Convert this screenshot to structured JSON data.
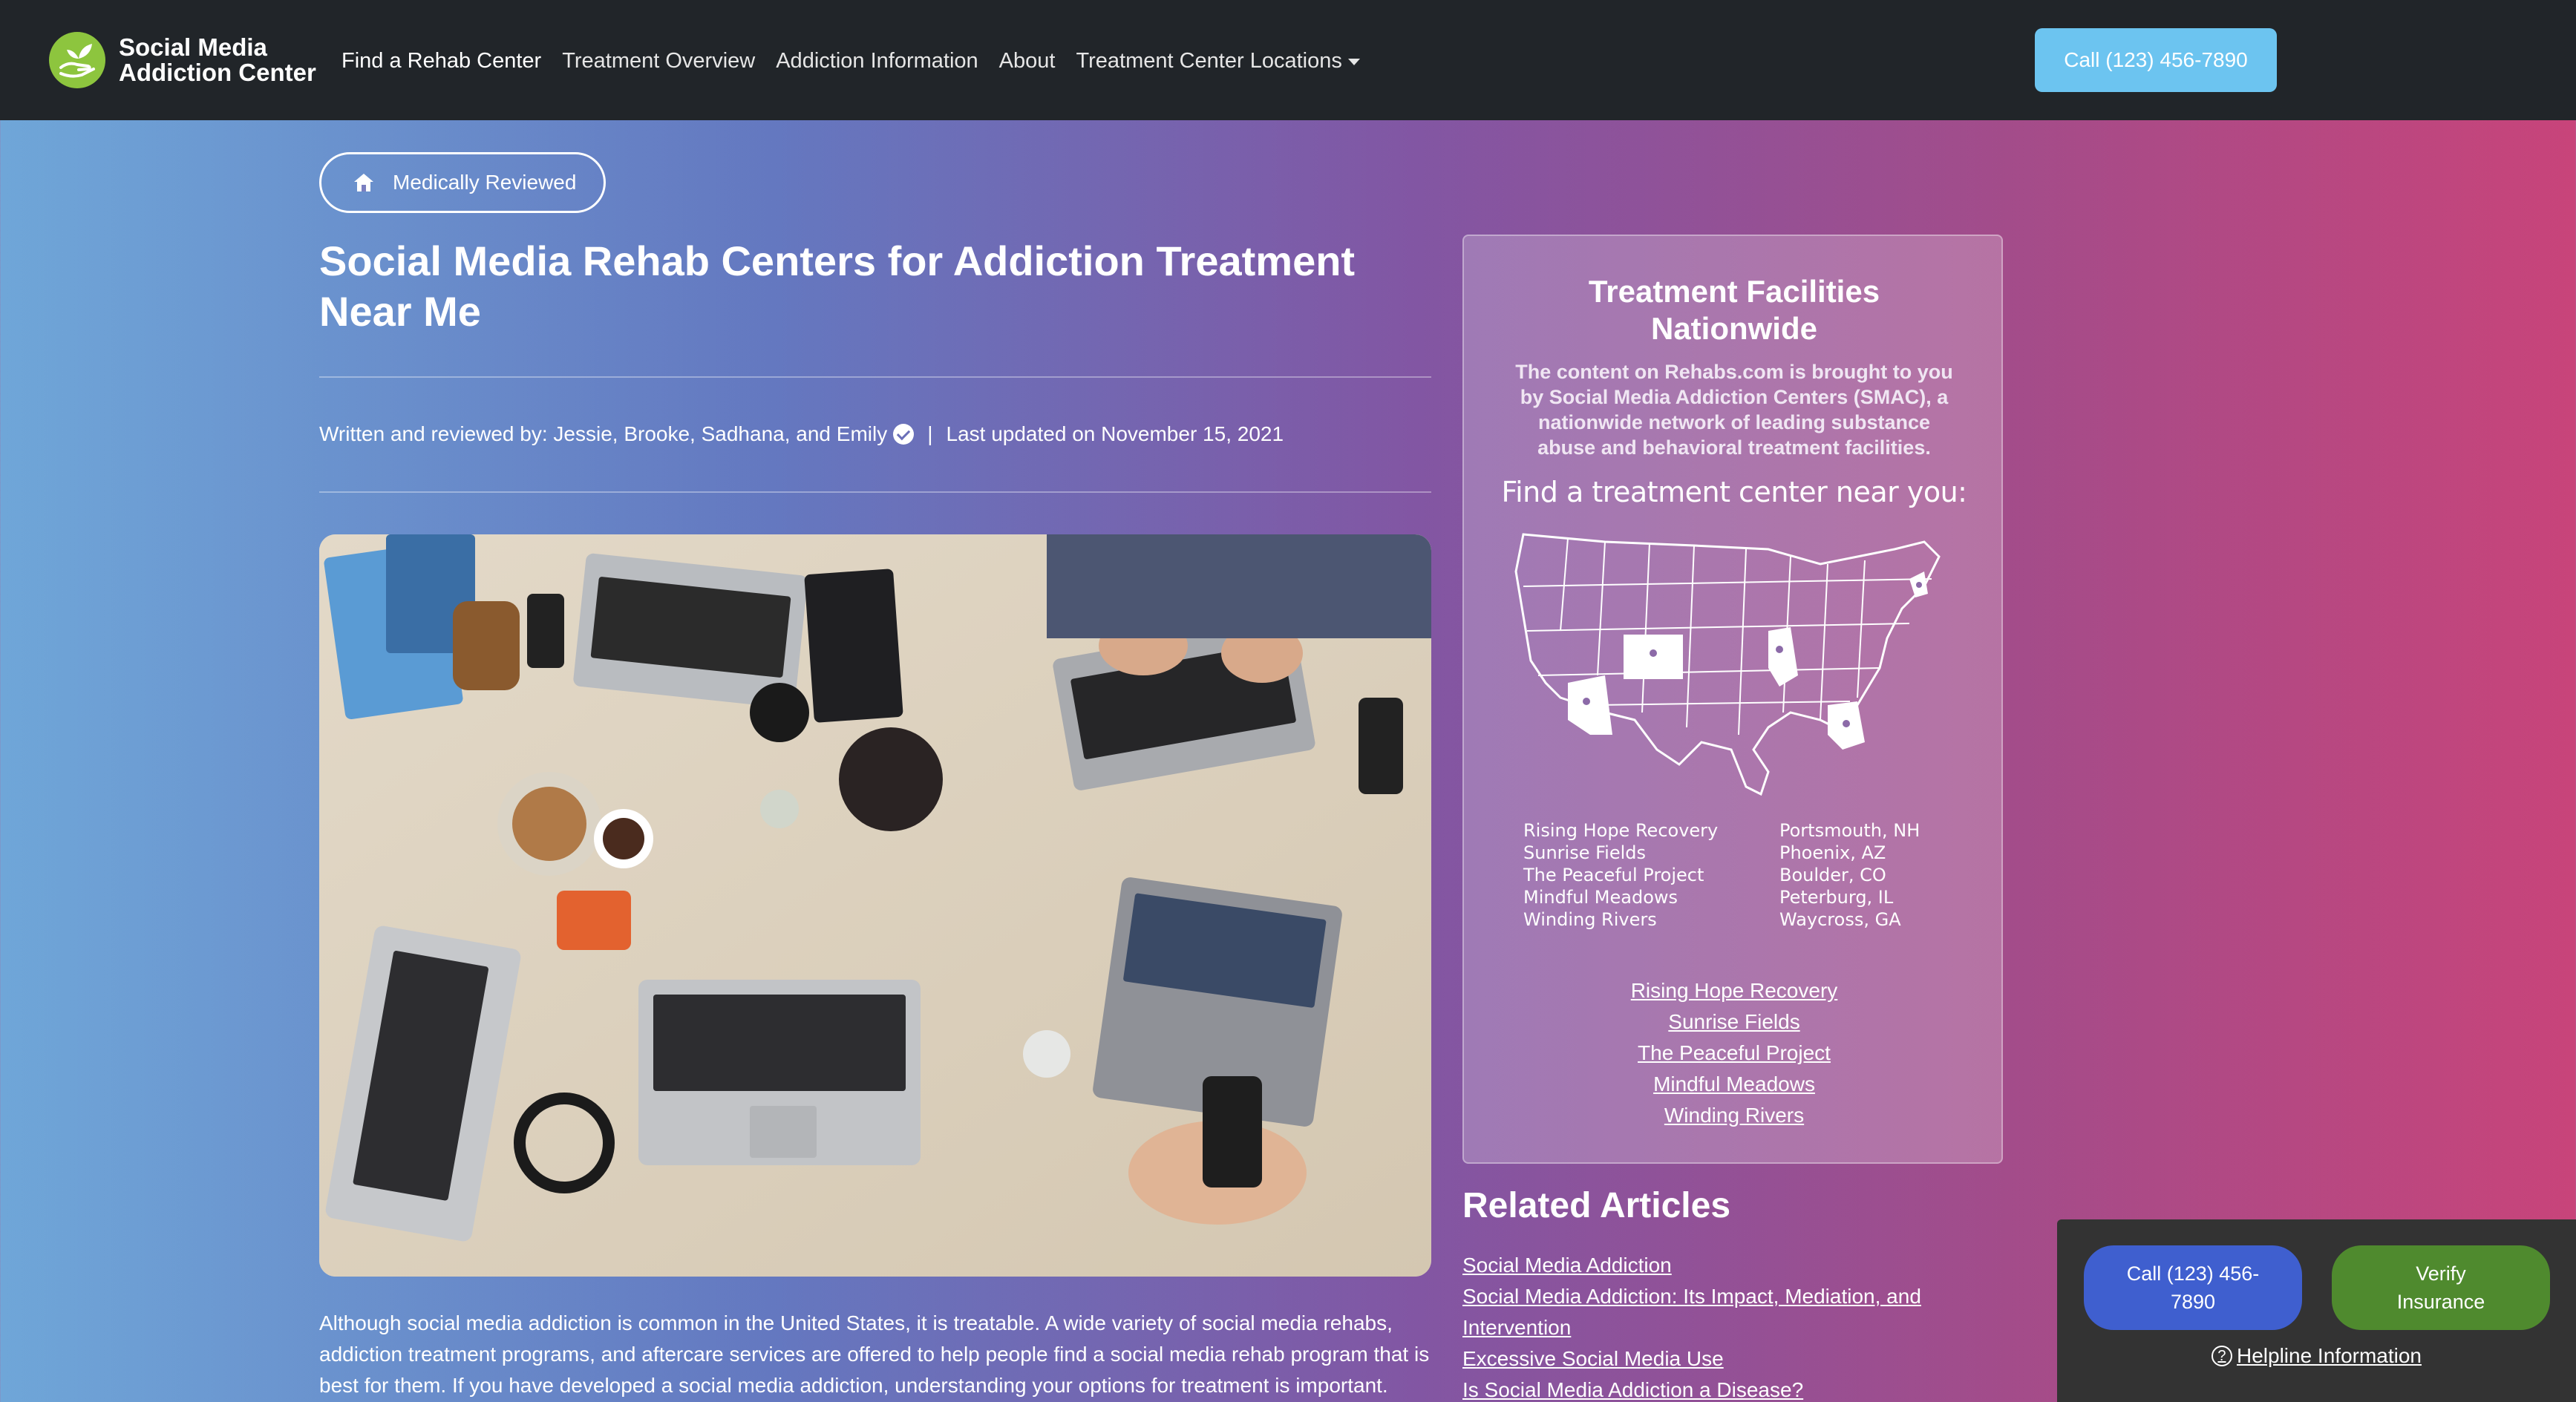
{
  "navbar": {
    "brand": "Social Media Addiction Center",
    "brand_line1": "Social Media",
    "brand_line2": "Addiction Center",
    "links": [
      "Find a Rehab Center",
      "Treatment Overview",
      "Addiction Information",
      "About",
      "Treatment Center Locations"
    ],
    "call_label": "Call (123) 456-7890"
  },
  "article": {
    "badge": "Medically Reviewed",
    "title": "Social Media Rehab Centers for Addiction Treatment Near Me",
    "byline": "Written and reviewed by: Jessie, Brooke, Sadhana, and Emily",
    "separator": "|",
    "updated": "Last updated on November 15, 2021",
    "intro": "Although social media addiction is common in the United States, it is treatable. A wide variety of social media rehabs, addiction treatment programs, and aftercare services are offered to help people find a social media rehab program that is best for them. If you have developed a social media addiction, understanding your options for treatment is important."
  },
  "panel": {
    "title": "Treatment Facilities Nationwide",
    "description": "The content on Rehabs.com is brought to you by Social Media Addiction Centers (SMAC), a nationwide network of leading substance abuse and behavioral treatment facilities.",
    "find_label": "Find a treatment center near you:",
    "facilities": [
      {
        "name": "Rising Hope Recovery",
        "location": "Portsmouth, NH"
      },
      {
        "name": "Sunrise Fields",
        "location": "Phoenix, AZ"
      },
      {
        "name": "The Peaceful Project",
        "location": "Boulder, CO"
      },
      {
        "name": "Mindful Meadows",
        "location": "Peterburg, IL"
      },
      {
        "name": "Winding Rivers",
        "location": "Waycross, GA"
      }
    ]
  },
  "related": {
    "title": "Related Articles",
    "links": [
      "Social Media Addiction",
      "Social Media Addiction: Its Impact, Mediation, and Intervention",
      "Excessive Social Media Use",
      "Is Social Media Addiction a Disease?"
    ]
  },
  "floating": {
    "call_label": "Call (123) 456-7890",
    "verify_label": "Verify Insurance",
    "helpline_label": "Helpline Information"
  },
  "icons": {
    "brand_logo": "hand-leaf-logo",
    "badge": "home-icon",
    "verified": "check-circle-icon",
    "map": "us-map-icon",
    "helpline": "question-circle-icon"
  },
  "colors": {
    "navbar": "#212529",
    "call_button": "#6cc4f0",
    "float_call": "#3f5fcf",
    "float_verify": "#4f8a2e",
    "logo": "#8dc53e"
  }
}
